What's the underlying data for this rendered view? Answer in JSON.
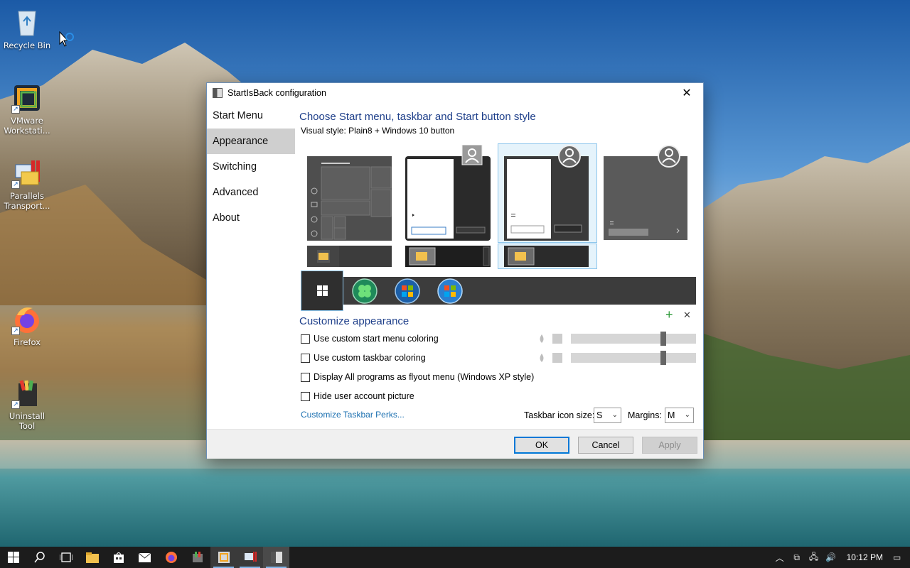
{
  "desktop": {
    "icons": [
      {
        "label": "Recycle Bin"
      },
      {
        "label": "VMware Workstati..."
      },
      {
        "label": "Parallels Transport..."
      },
      {
        "label": "Firefox"
      },
      {
        "label": "Uninstall Tool"
      }
    ]
  },
  "dialog": {
    "title": "StartIsBack configuration",
    "close_glyph": "✕",
    "nav": [
      "Start Menu",
      "Appearance",
      "Switching",
      "Advanced",
      "About"
    ],
    "active_nav": "Appearance",
    "heading": "Choose Start menu, taskbar and Start button style",
    "visual_style": "Visual style:  Plain8 + Windows 10 button",
    "customize_heading": "Customize appearance",
    "add_glyph": "+",
    "remove_glyph": "✕",
    "options": {
      "start_coloring": "Use custom start menu coloring",
      "taskbar_coloring": "Use custom taskbar coloring",
      "flyout": "Display All programs as flyout menu (Windows XP style)",
      "hide_picture": "Hide user account picture"
    },
    "perks_link": "Customize Taskbar Perks...",
    "icon_size_label": "Taskbar icon size:",
    "icon_size_value": "S",
    "margins_label": "Margins:",
    "margins_value": "M",
    "buttons": {
      "ok": "OK",
      "cancel": "Cancel",
      "apply": "Apply"
    },
    "sliders": {
      "start_level": 0.75,
      "taskbar_level": 0.75
    }
  },
  "taskbar": {
    "clock": "10:12 PM"
  },
  "colors": {
    "accent_blue": "#1e3f8a",
    "link_blue": "#1a6fb0",
    "selection": "#8ec6ec",
    "taskbar_bg": "#1c1c1c"
  }
}
